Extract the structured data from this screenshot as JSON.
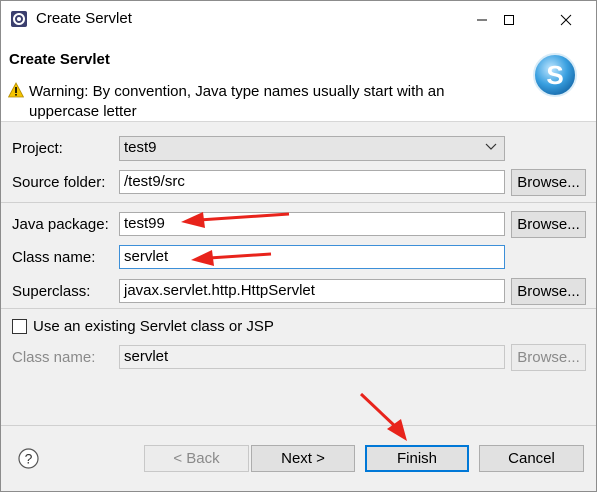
{
  "window": {
    "title": "Create Servlet",
    "minimize_glyph": "—",
    "close_glyph": "✕"
  },
  "header": {
    "title": "Create Servlet",
    "warning": "Warning: By convention, Java type names usually start with an uppercase letter",
    "logo_letter": "S"
  },
  "form": {
    "project_label": "Project:",
    "project_value": "test9",
    "source_folder_label": "Source folder:",
    "source_folder_value": "/test9/src",
    "java_package_label": "Java package:",
    "java_package_value": "test99",
    "class_name_label": "Class name:",
    "class_name_value": "servlet",
    "superclass_label": "Superclass:",
    "superclass_value": "javax.servlet.http.HttpServlet",
    "browse_label": "Browse...",
    "use_existing_label": "Use an existing Servlet class or JSP",
    "use_existing_checked": false,
    "existing_class_label": "Class name:",
    "existing_class_value": "servlet"
  },
  "footer": {
    "back_label": "< Back",
    "next_label": "Next >",
    "finish_label": "Finish",
    "cancel_label": "Cancel"
  },
  "colors": {
    "annotation_arrow": "#e8231b",
    "default_button_border": "#0078d7",
    "focus_border": "#3c8fd8"
  },
  "icons": [
    "eclipse-app-icon",
    "minimize-icon",
    "maximize-icon",
    "close-icon",
    "warning-icon",
    "servlet-logo-icon",
    "chevron-down-icon",
    "help-icon",
    "red-arrow-annotation"
  ]
}
